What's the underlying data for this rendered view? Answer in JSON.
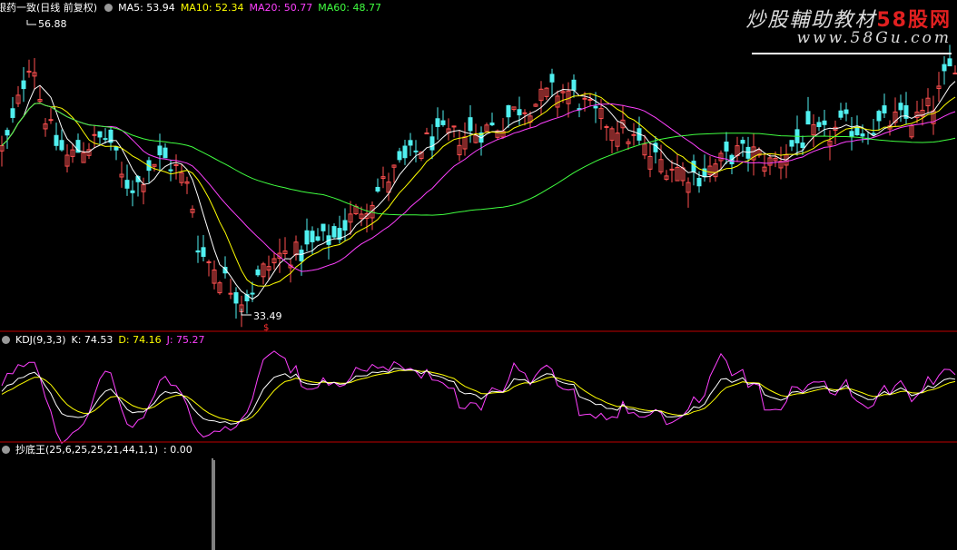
{
  "header_main": {
    "title": "银药一致(日线 前复权)",
    "ma5": "MA5: 53.94",
    "ma10": "MA10: 52.34",
    "ma20": "MA20: 50.77",
    "ma60": "MA60: 48.77"
  },
  "header_kdj": {
    "title": "KDJ(9,3,3)",
    "k": "K: 74.53",
    "d": "D: 74.16",
    "j": "J: 75.27"
  },
  "header_cdw": {
    "title": "抄底王(25,6,25,25,21,44,1,1)",
    "value": ": 0.00"
  },
  "watermark": {
    "line1_a": "炒股輔助教材",
    "line1_b": "58股网",
    "line2": "www.58Gu.com"
  },
  "annotations": {
    "high_label": "56.88",
    "low_label": "33.49",
    "signal_glyph": "$"
  },
  "colors": {
    "bg": "#000000",
    "up": "#ff5050",
    "down": "#50f0f0",
    "ma5": "#ffffff",
    "ma10": "#ffff00",
    "ma20": "#ff40ff",
    "ma60": "#40ff40",
    "kdj_k": "#ffffff",
    "kdj_d": "#ffff00",
    "kdj_j": "#ff40ff",
    "divider": "#c00000"
  },
  "chart_data": [
    {
      "type": "candlestick",
      "panel": "price",
      "ylim": [
        32,
        60
      ],
      "high": 56.88,
      "low": 33.49,
      "close_anchors": [
        [
          0,
          47.5
        ],
        [
          10,
          49
        ],
        [
          20,
          52
        ],
        [
          28,
          54.5
        ],
        [
          35,
          56.5
        ],
        [
          45,
          52
        ],
        [
          60,
          48.5
        ],
        [
          75,
          47
        ],
        [
          90,
          48
        ],
        [
          105,
          48.5
        ],
        [
          120,
          49
        ],
        [
          135,
          45
        ],
        [
          150,
          44.5
        ],
        [
          165,
          46.5
        ],
        [
          180,
          47
        ],
        [
          195,
          46
        ],
        [
          210,
          44
        ],
        [
          215,
          41
        ],
        [
          220,
          38.5
        ],
        [
          235,
          37.5
        ],
        [
          250,
          36
        ],
        [
          265,
          34.5
        ],
        [
          275,
          35
        ],
        [
          290,
          37
        ],
        [
          310,
          38.5
        ],
        [
          330,
          38.5
        ],
        [
          350,
          39.5
        ],
        [
          370,
          40
        ],
        [
          390,
          42
        ],
        [
          410,
          43.5
        ],
        [
          430,
          45.5
        ],
        [
          450,
          47
        ],
        [
          470,
          48.5
        ],
        [
          490,
          49
        ],
        [
          510,
          49
        ],
        [
          530,
          49.5
        ],
        [
          550,
          50
        ],
        [
          570,
          51.5
        ],
        [
          590,
          52
        ],
        [
          610,
          53
        ],
        [
          625,
          53
        ],
        [
          640,
          52
        ],
        [
          660,
          50.5
        ],
        [
          680,
          50
        ],
        [
          700,
          48.5
        ],
        [
          720,
          47
        ],
        [
          735,
          46.5
        ],
        [
          750,
          46
        ],
        [
          770,
          45.5
        ],
        [
          790,
          46.5
        ],
        [
          810,
          47.5
        ],
        [
          830,
          47.5
        ],
        [
          850,
          46.5
        ],
        [
          870,
          48
        ],
        [
          890,
          49
        ],
        [
          910,
          49
        ],
        [
          930,
          50
        ],
        [
          950,
          49.5
        ],
        [
          970,
          50
        ],
        [
          990,
          50.5
        ],
        [
          1010,
          50.5
        ],
        [
          1030,
          52
        ],
        [
          1040,
          54
        ],
        [
          1054,
          56
        ]
      ]
    },
    {
      "type": "line",
      "panel": "kdj",
      "ylim": [
        -10,
        120
      ],
      "series": [
        {
          "name": "K",
          "values_ref": "derived"
        },
        {
          "name": "D",
          "values_ref": "derived"
        },
        {
          "name": "J",
          "values_ref": "derived"
        }
      ],
      "last_values": {
        "K": 74.53,
        "D": 74.16,
        "J": 75.27
      }
    },
    {
      "type": "bar",
      "panel": "cdw",
      "ylim": [
        0,
        100
      ],
      "spikes": [
        [
          235,
          100
        ]
      ],
      "last_value": 0.0
    }
  ]
}
